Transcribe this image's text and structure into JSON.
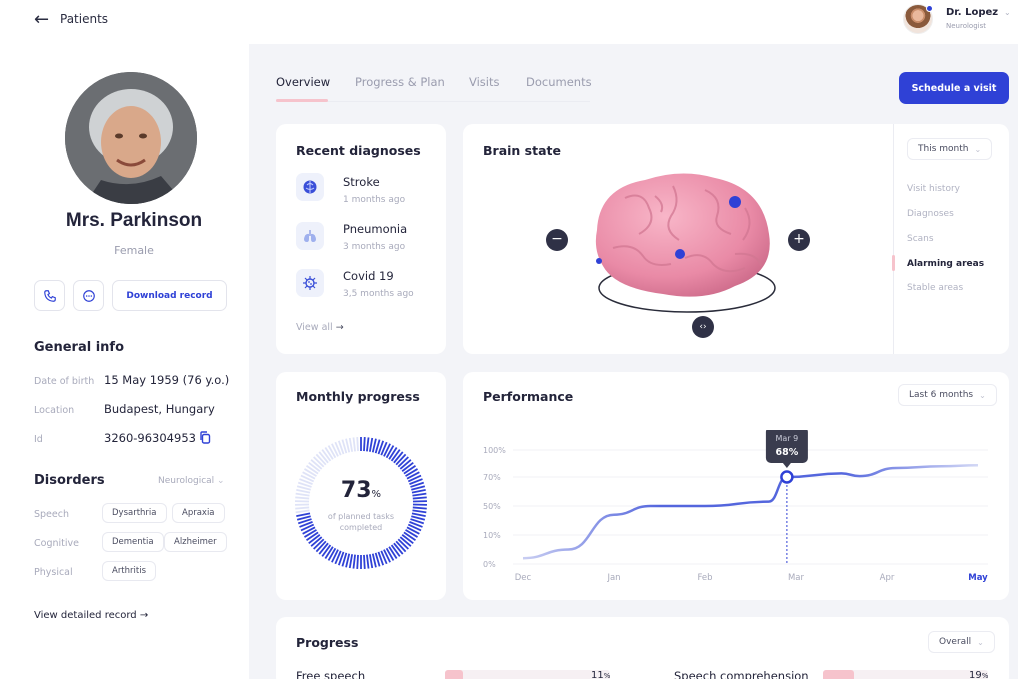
{
  "topbar": {
    "back_label": "Patients",
    "doctor_name": "Dr. Lopez",
    "doctor_role": "Neurologist"
  },
  "patient": {
    "name": "Mrs. Parkinson",
    "gender": "Female",
    "download_label": "Download record",
    "general_info_title": "General info",
    "info": [
      {
        "label": "Date of birth",
        "value": "15 May 1959 (76 y.o.)"
      },
      {
        "label": "Location",
        "value": "Budapest, Hungary"
      },
      {
        "label": "Id",
        "value": "3260-96304953"
      }
    ],
    "disorders_title": "Disorders",
    "disorders_filter": "Neurological",
    "disorders": [
      {
        "label": "Speech",
        "tags": [
          "Dysarthria",
          "Apraxia"
        ]
      },
      {
        "label": "Cognitive",
        "tags": [
          "Dementia",
          "Alzheimer"
        ]
      },
      {
        "label": "Physical",
        "tags": [
          "Arthritis"
        ]
      }
    ],
    "view_record_label": "View detailed record"
  },
  "tabs": [
    "Overview",
    "Progress & Plan",
    "Visits",
    "Documents"
  ],
  "schedule_label": "Schedule a visit",
  "recent_diagnoses": {
    "title": "Recent diagnoses",
    "items": [
      {
        "name": "Stroke",
        "time": "1 months ago",
        "icon": "brain-icon"
      },
      {
        "name": "Pneumonia",
        "time": "3 months ago",
        "icon": "lungs-icon"
      },
      {
        "name": "Covid 19",
        "time": "3,5 months ago",
        "icon": "virus-icon"
      }
    ],
    "view_all": "View all"
  },
  "brain_state": {
    "title": "Brain state",
    "period": "This month",
    "menu": [
      "Visit history",
      "Diagnoses",
      "Scans",
      "Alarming areas",
      "Stable areas"
    ],
    "active_menu": "Alarming areas"
  },
  "monthly_progress": {
    "title": "Monthly progress",
    "value": "73",
    "unit": "%",
    "percent": 73,
    "caption": "of planned tasks completed"
  },
  "chart_data": {
    "type": "line",
    "title": "Performance",
    "period": "Last 6 months",
    "x": [
      "Dec",
      "Jan",
      "Feb",
      "Mar",
      "Apr",
      "May"
    ],
    "active_x": "May",
    "y_ticks": [
      "100%",
      "70%",
      "50%",
      "10%",
      "0%"
    ],
    "series": [
      {
        "values": [
          [
            0,
            2
          ],
          [
            0.5,
            5
          ],
          [
            1,
            38
          ],
          [
            1.4,
            50
          ],
          [
            2,
            50
          ],
          [
            2.7,
            53
          ],
          [
            2.9,
            70
          ],
          [
            3.5,
            74
          ],
          [
            3.7,
            71
          ],
          [
            4.1,
            80
          ],
          [
            4.6,
            82
          ],
          [
            5,
            83
          ]
        ]
      }
    ],
    "tooltip": {
      "date": "Mar 9",
      "value": "68%",
      "x": 2.9,
      "y": 70
    }
  },
  "progress": {
    "title": "Progress",
    "filter": "Overall",
    "items": [
      {
        "label": "Free speech",
        "value": "11",
        "unit": "%",
        "fraction": 0.11
      },
      {
        "label": "Speech comprehension",
        "value": "19",
        "unit": "%",
        "fraction": 0.19
      }
    ]
  },
  "colors": {
    "accent": "#2f41d6",
    "pink": "#f6c3cc",
    "background": "#f3f4f8"
  }
}
